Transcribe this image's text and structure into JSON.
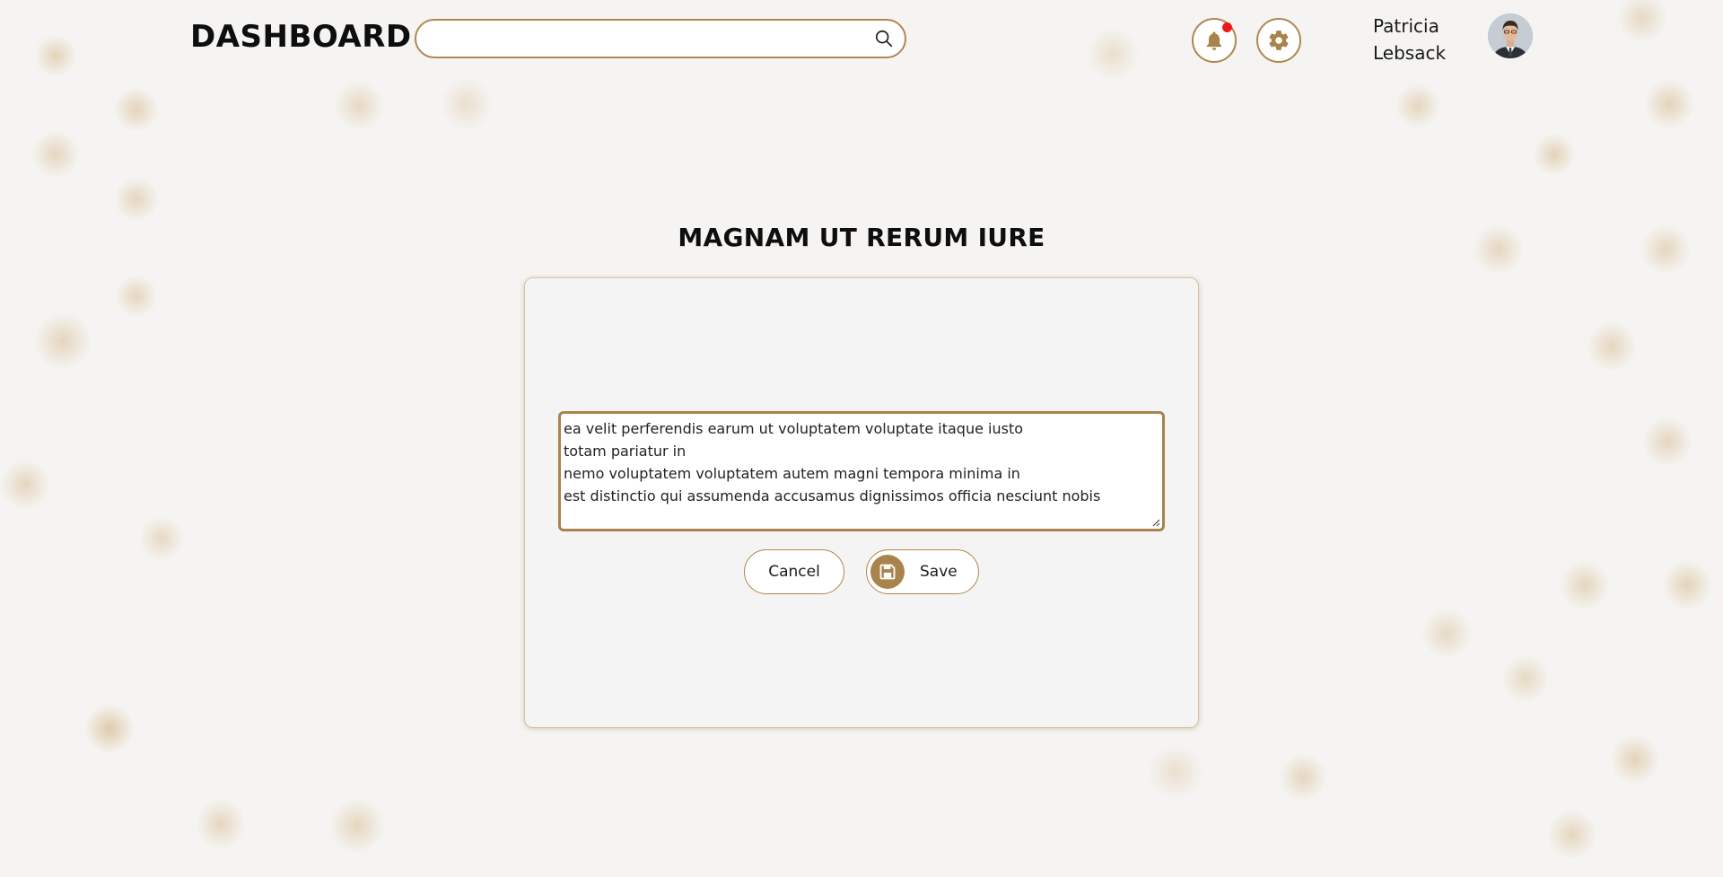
{
  "header": {
    "brand": "DASHBOARD",
    "search": {
      "value": "",
      "placeholder": ""
    },
    "notifications": {
      "has_unread": true
    },
    "user": {
      "first_name": "Patricia",
      "last_name": "Lebsack"
    }
  },
  "main": {
    "title": "MAGNAM UT RERUM IURE",
    "editor_lines": [
      "ea velit perferendis earum ut voluptatem voluptate itaque iusto",
      "totam pariatur in",
      "nemo voluptatem voluptatem autem magni tempora minima in",
      "est distinctio qui assumenda accusamus dignissimos officia nesciunt nobis"
    ],
    "cancel_label": "Cancel",
    "save_label": "Save"
  },
  "icons": {
    "search": "search-icon",
    "bell": "bell-icon",
    "gear": "gear-icon",
    "save": "floppy-disk-icon"
  },
  "colors": {
    "accent": "#b0874e",
    "notification_dot": "#ee1a1a",
    "background": "#f5f4f2"
  }
}
